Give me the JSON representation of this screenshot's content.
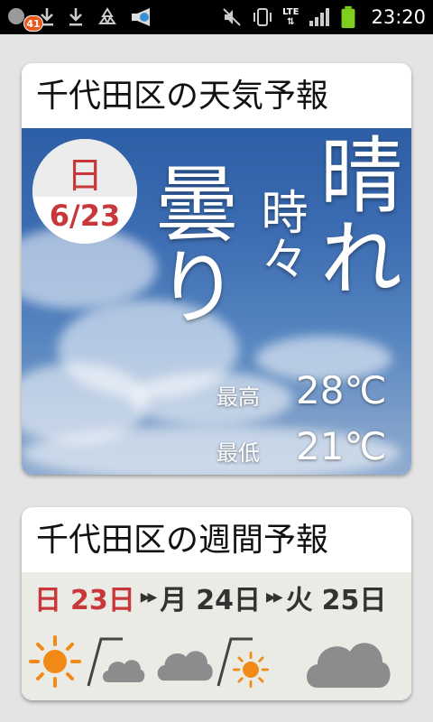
{
  "status_bar": {
    "time": "23:20",
    "notification_count": "41",
    "network": "LTE",
    "icons": [
      "notification-icon",
      "download-icon",
      "download-icon",
      "recycle-icon",
      "megaphone-icon",
      "mute-icon",
      "vibrate-icon",
      "lte-icon",
      "signal-icon",
      "battery-icon"
    ]
  },
  "today_card": {
    "title": "千代田区の天気予報",
    "day_of_week": "日",
    "date": "6/23",
    "forecast_main": "晴れ",
    "forecast_connector": "時々",
    "forecast_secondary": "曇り",
    "high_label": "最高",
    "high_temp": "28℃",
    "low_label": "最低",
    "low_temp": "21℃"
  },
  "week_card": {
    "title": "千代田区の週間予報",
    "days": [
      {
        "dow": "日",
        "day": "23日",
        "icons": [
          "sun-icon",
          "cloud-icon"
        ]
      },
      {
        "dow": "月",
        "day": "24日",
        "icons": [
          "cloud-icon",
          "sun-icon"
        ]
      },
      {
        "dow": "火",
        "day": "25日",
        "icons": [
          "cloud-icon"
        ]
      }
    ]
  },
  "colors": {
    "sunday_red": "#c8373a",
    "sun_orange": "#f28a17",
    "cloud_gray": "#8c8c8c"
  }
}
